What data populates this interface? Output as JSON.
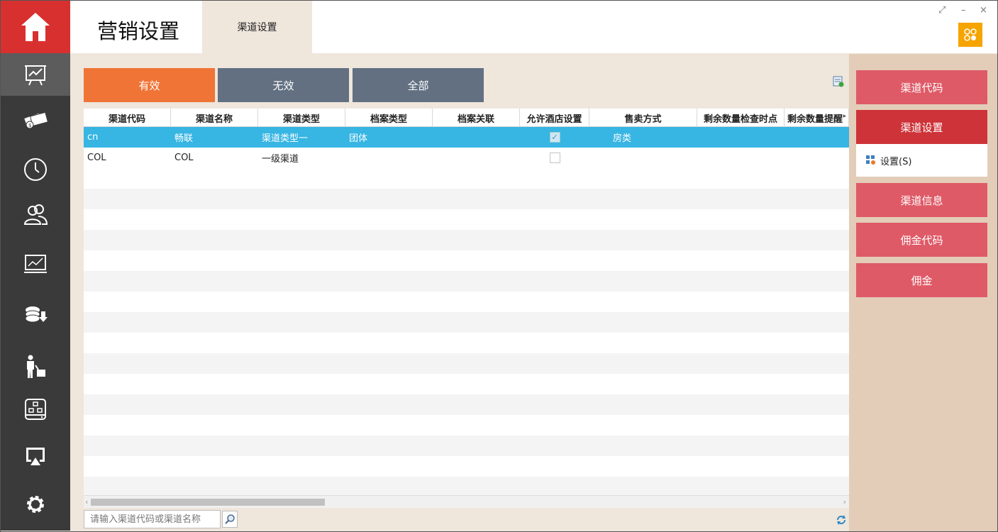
{
  "header": {
    "title": "营销设置",
    "tab_label": "渠道设置"
  },
  "window": {
    "restore": "⤢",
    "minimize": "–",
    "close": "×"
  },
  "filters": [
    {
      "label": "有效",
      "active": true
    },
    {
      "label": "无效",
      "active": false
    },
    {
      "label": "全部",
      "active": false
    }
  ],
  "grid": {
    "columns": [
      "渠道代码",
      "渠道名称",
      "渠道类型",
      "档案类型",
      "档案关联",
      "允许酒店设置",
      "售卖方式",
      "剩余数量检查时点",
      "剩余数量提醒"
    ],
    "rows": [
      {
        "code": "cn",
        "name": "畅联",
        "type": "渠道类型一",
        "profile_type": "团体",
        "profile_link": "",
        "allow_hotel": true,
        "sale_mode": "房类",
        "check_time": "",
        "remind": "",
        "selected": true
      },
      {
        "code": "COL",
        "name": "COL",
        "type": "一级渠道",
        "profile_type": "",
        "profile_link": "",
        "allow_hotel": false,
        "sale_mode": "",
        "check_time": "",
        "remind": "",
        "selected": false
      }
    ]
  },
  "search": {
    "placeholder": "请输入渠道代码或渠道名称"
  },
  "right_panel": {
    "buttons": [
      "渠道代码",
      "渠道设置",
      "渠道信息",
      "佣金代码",
      "佣金"
    ],
    "sub_item": "设置(S)"
  },
  "colors": {
    "accent_orange": "#ef7436",
    "slate": "#627082",
    "selected_row": "#37b5e3",
    "right_button": "#df5a67",
    "right_button_active": "#cd3338",
    "home_red": "#d8302f"
  }
}
